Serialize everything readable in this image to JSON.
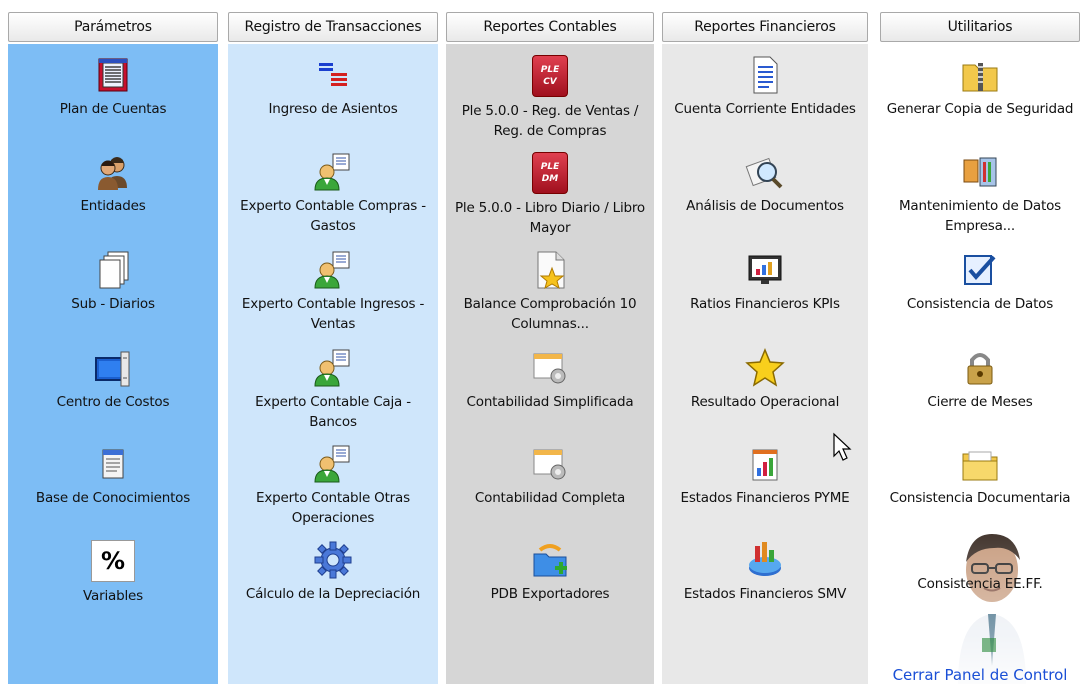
{
  "colors": {
    "parametros_bg": "#7dbdf5",
    "registro_bg": "#cfe6fb",
    "reportes_contables_bg": "#d6d6d6",
    "reportes_financieros_bg": "#e8e8e8",
    "utilitarios_bg": "#ffffff",
    "close_link": "#1a4fd6"
  },
  "parametros": {
    "header": "Parámetros",
    "items": [
      {
        "label": "Plan de Cuentas",
        "icon": "ledger-book-icon"
      },
      {
        "label": "Entidades",
        "icon": "people-icon"
      },
      {
        "label": "Sub - Diarios",
        "icon": "stacked-pages-icon"
      },
      {
        "label": "Centro de Costos",
        "icon": "monitor-icon"
      },
      {
        "label": "Base de Conocimientos",
        "icon": "notepad-icon"
      },
      {
        "label": "Variables",
        "icon": "percent-icon",
        "glyph": "%"
      }
    ]
  },
  "registro": {
    "header": "Registro de Transacciones",
    "items": [
      {
        "label": "Ingreso de Asientos",
        "icon": "colored-lines-icon"
      },
      {
        "label": "Experto Contable Compras - Gastos",
        "icon": "user-document-icon"
      },
      {
        "label": "Experto Contable Ingresos - Ventas",
        "icon": "user-document-icon"
      },
      {
        "label": "Experto Contable Caja - Bancos",
        "icon": "user-document-icon"
      },
      {
        "label": "Experto Contable Otras Operaciones",
        "icon": "user-document-icon"
      },
      {
        "label": "Cálculo de la Depreciación",
        "icon": "gear-icon"
      }
    ]
  },
  "reportes_contables": {
    "header": "Reportes Contables",
    "items": [
      {
        "label": "Ple 5.0.0 - Reg. de Ventas / Reg. de Compras",
        "icon": "ple-cv-icon",
        "badge_top": "PLE",
        "badge_bottom": "CV"
      },
      {
        "label": "Ple 5.0.0 - Libro Diario / Libro Mayor",
        "icon": "ple-dm-icon",
        "badge_top": "PLE",
        "badge_bottom": "DM"
      },
      {
        "label": "Balance Comprobación 10 Columnas...",
        "icon": "document-star-icon"
      },
      {
        "label": "Contabilidad Simplificada",
        "icon": "window-gear-icon"
      },
      {
        "label": "Contabilidad Completa",
        "icon": "window-gear-icon"
      },
      {
        "label": "PDB Exportadores",
        "icon": "export-folder-icon"
      }
    ]
  },
  "reportes_financieros": {
    "header": "Reportes Financieros",
    "items": [
      {
        "label": "Cuenta Corriente Entidades",
        "icon": "document-lines-icon"
      },
      {
        "label": "Análisis de Documentos",
        "icon": "magnifier-icon"
      },
      {
        "label": "Ratios Financieros KPIs",
        "icon": "chart-monitor-icon"
      },
      {
        "label": "Resultado Operacional",
        "icon": "star-icon"
      },
      {
        "label": "Estados Financieros  PYME",
        "icon": "bar-chart-document-icon"
      },
      {
        "label": "Estados Financieros SMV",
        "icon": "pie-chart-icon"
      }
    ]
  },
  "utilitarios": {
    "header": "Utilitarios",
    "items": [
      {
        "label": "Generar Copia de Seguridad",
        "icon": "zip-folder-icon"
      },
      {
        "label": "Mantenimiento de Datos Empresa...",
        "icon": "tools-icon"
      },
      {
        "label": "Consistencia de Datos",
        "icon": "checkmark-board-icon"
      },
      {
        "label": "Cierre de Meses",
        "icon": "padlock-icon"
      },
      {
        "label": "Consistencia Documentaria",
        "icon": "folder-icon"
      },
      {
        "label": "Consistencia EE.FF.",
        "icon": "presenter-overlay"
      }
    ],
    "close_link": "Cerrar Panel de Control"
  }
}
